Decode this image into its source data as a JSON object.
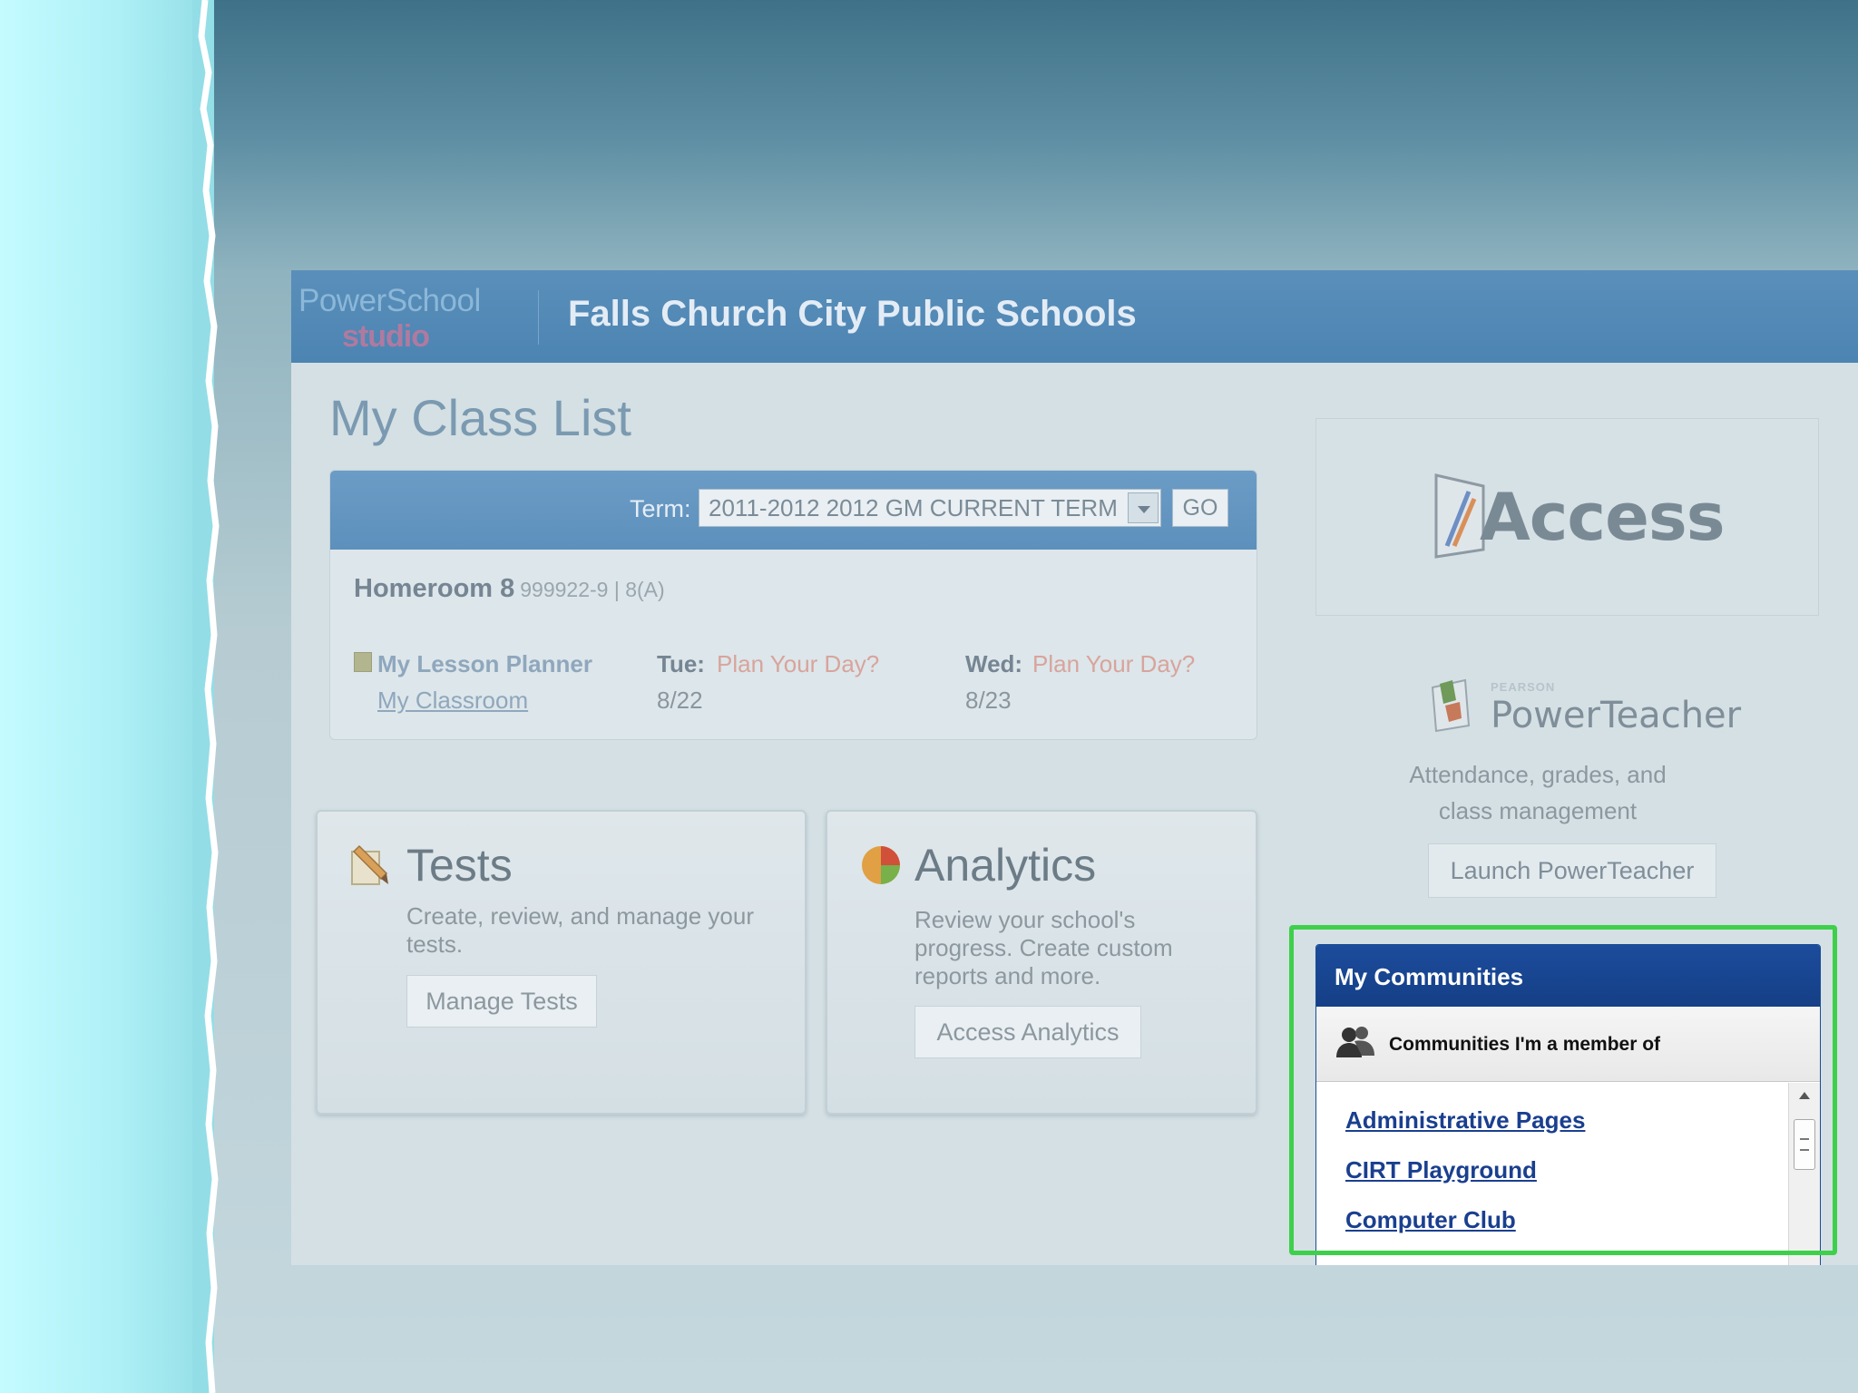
{
  "header": {
    "logo_top": "PowerSchool",
    "logo_bottom": "studio",
    "school_name": "Falls Church City Public Schools"
  },
  "page_title": "My Class List",
  "term": {
    "label": "Term:",
    "selected": "2011-2012 2012 GM CURRENT TERM",
    "go_label": "GO"
  },
  "homeroom": {
    "name": "Homeroom 8",
    "code": "999922-9 | 8(A)",
    "lesson_planner": "My Lesson Planner",
    "classroom": "My Classroom",
    "days": [
      {
        "label": "Tue:",
        "plan": "Plan Your Day?",
        "date": "8/22"
      },
      {
        "label": "Wed:",
        "plan": "Plan Your Day?",
        "date": "8/23"
      }
    ]
  },
  "tests": {
    "title": "Tests",
    "description": "Create, review, and manage your tests.",
    "button": "Manage Tests"
  },
  "analytics": {
    "title": "Analytics",
    "description": "Review your school's progress. Create custom reports and more.",
    "button": "Access Analytics"
  },
  "access": {
    "logo_text": "Access"
  },
  "powerteacher": {
    "brand_small": "PEARSON",
    "title": "PowerTeacher",
    "description": "Attendance, grades, and class management",
    "button": "Launch PowerTeacher"
  },
  "communities": {
    "title": "My Communities",
    "subtitle": "Communities I'm a member of",
    "items": [
      "Administrative Pages",
      "CIRT Playground",
      "Computer Club"
    ],
    "highlight_color": "#3ed04a"
  },
  "icons": {
    "lesson_planner": "planner-icon",
    "tests": "pencil-icon",
    "analytics": "pie-chart-icon",
    "access": "access-logo-icon",
    "powerteacher": "powerteacher-logo-icon",
    "communities": "people-icon"
  }
}
